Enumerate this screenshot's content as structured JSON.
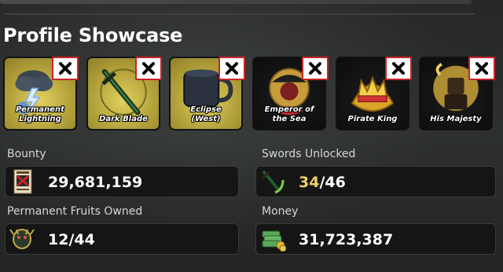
{
  "profile": {
    "title": "Profile Showcase",
    "showcase": [
      {
        "label_line1": "Permanent",
        "label_line2": "Lightning",
        "icon": "lightning-cloud-icon",
        "style": "gold"
      },
      {
        "label_line1": "Dark Blade",
        "label_line2": "",
        "icon": "dark-blade-icon",
        "style": "gold"
      },
      {
        "label_line1": "Eclipse",
        "label_line2": "(West)",
        "icon": "eclipse-mug-icon",
        "style": "gold"
      },
      {
        "label_line1": "Emperor of",
        "label_line2": "the Sea",
        "icon": "pirate-emblem-icon",
        "style": "dark"
      },
      {
        "label_line1": "Pirate King",
        "label_line2": "",
        "icon": "crown-icon",
        "style": "dark"
      },
      {
        "label_line1": "His Majesty",
        "label_line2": "",
        "icon": "majesty-avatar-icon",
        "style": "dark"
      }
    ],
    "remove_icon": "close-icon"
  },
  "stats": {
    "bounty": {
      "label": "Bounty",
      "value": "29,681,159",
      "icon": "wanted-poster-icon"
    },
    "swords": {
      "label": "Swords Unlocked",
      "value_current": "34",
      "value_rest": "/46",
      "icon": "sword-icon"
    },
    "fruits": {
      "label": "Permanent Fruits Owned",
      "value": "12/44",
      "icon": "dragon-fruit-icon"
    },
    "money": {
      "label": "Money",
      "value": "31,723,387",
      "icon": "money-stack-icon"
    }
  },
  "colors": {
    "accent_gold": "#f1d06a",
    "remove_red": "#c8242a",
    "card_gold": "#c9b84a"
  }
}
